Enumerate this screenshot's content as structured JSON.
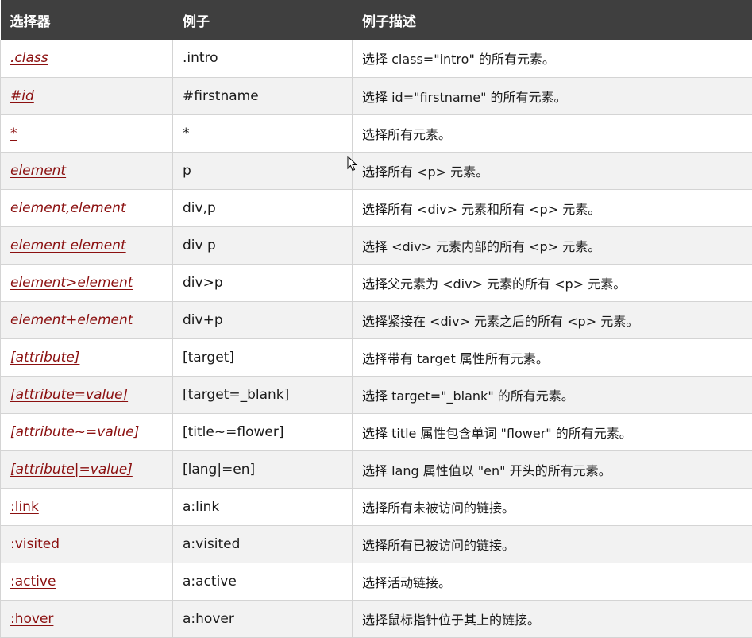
{
  "header": {
    "col_selector": "选择器",
    "col_example": "例子",
    "col_description": "例子描述"
  },
  "rows": [
    {
      "selector": ".class",
      "italic": true,
      "example": ".intro",
      "description": "选择 class=\"intro\" 的所有元素。"
    },
    {
      "selector": "#id",
      "italic": true,
      "example": "#firstname",
      "description": "选择 id=\"firstname\" 的所有元素。"
    },
    {
      "selector": "*",
      "italic": true,
      "example": "*",
      "description": "选择所有元素。"
    },
    {
      "selector": "element",
      "italic": true,
      "example": "p",
      "description": "选择所有 <p> 元素。"
    },
    {
      "selector": "element,element",
      "italic": true,
      "example": "div,p",
      "description": "选择所有 <div> 元素和所有 <p> 元素。"
    },
    {
      "selector": "element element",
      "italic": true,
      "example": "div p",
      "description": "选择 <div> 元素内部的所有 <p> 元素。"
    },
    {
      "selector": "element>element",
      "italic": true,
      "example": "div>p",
      "description": "选择父元素为 <div> 元素的所有 <p> 元素。"
    },
    {
      "selector": "element+element",
      "italic": true,
      "example": "div+p",
      "description": "选择紧接在 <div> 元素之后的所有 <p> 元素。"
    },
    {
      "selector": "[attribute]",
      "italic": true,
      "example": "[target]",
      "description": "选择带有 target 属性所有元素。"
    },
    {
      "selector": "[attribute=value]",
      "italic": true,
      "example": "[target=_blank]",
      "description": "选择 target=\"_blank\" 的所有元素。"
    },
    {
      "selector": "[attribute~=value]",
      "italic": true,
      "example": "[title~=flower]",
      "description": "选择 title 属性包含单词 \"flower\" 的所有元素。"
    },
    {
      "selector": "[attribute|=value]",
      "italic": true,
      "example": "[lang|=en]",
      "description": "选择 lang 属性值以 \"en\" 开头的所有元素。"
    },
    {
      "selector": ":link",
      "italic": false,
      "example": "a:link",
      "description": "选择所有未被访问的链接。"
    },
    {
      "selector": ":visited",
      "italic": false,
      "example": "a:visited",
      "description": "选择所有已被访问的链接。"
    },
    {
      "selector": ":active",
      "italic": false,
      "example": "a:active",
      "description": "选择活动链接。"
    },
    {
      "selector": ":hover",
      "italic": false,
      "example": "a:hover",
      "description": "选择鼠标指针位于其上的链接。"
    }
  ],
  "colors": {
    "header_bg": "#3f3f3f",
    "link": "#8b1010",
    "stripe": "#f2f2f2",
    "border": "#d4d4d4"
  },
  "cursor_icon": "mouse-pointer-icon"
}
